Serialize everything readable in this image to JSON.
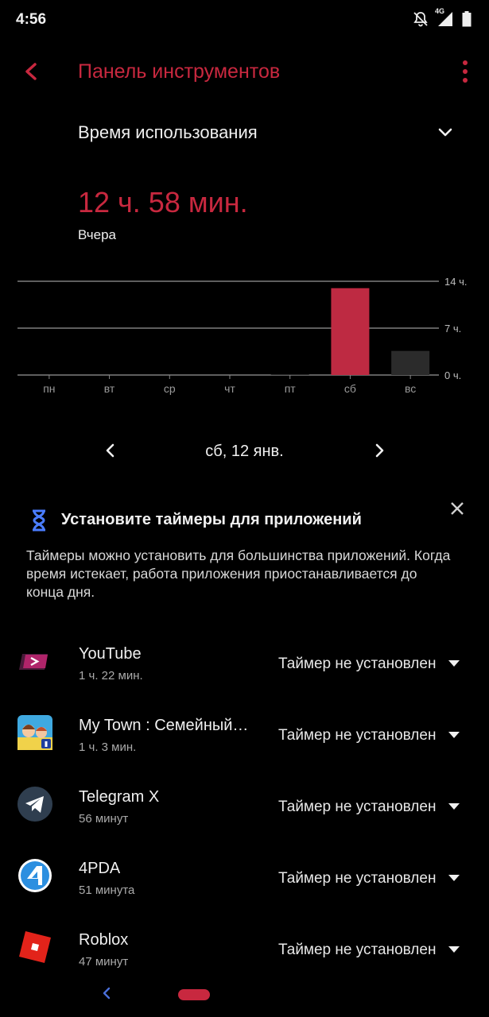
{
  "status_bar": {
    "time": "4:56",
    "network": "4G",
    "icons": [
      "bell-off-icon",
      "signal-icon",
      "battery-icon"
    ]
  },
  "app_bar": {
    "title": "Панель инструментов",
    "back_icon": "back-arrow-icon",
    "menu_icon": "more-vert-icon",
    "accent_color": "#c8283f"
  },
  "section_select": {
    "label": "Время использования",
    "icon": "chevron-down-icon"
  },
  "summary": {
    "total": "12 ч. 58 мин.",
    "day": "Вчера"
  },
  "chart_data": {
    "type": "bar",
    "categories": [
      "пн",
      "вт",
      "ср",
      "чт",
      "пт",
      "сб",
      "вс"
    ],
    "values": [
      0,
      0,
      0,
      0,
      0.05,
      12.97,
      3.6
    ],
    "selected_index": 5,
    "y_ticks": [
      "14 ч.",
      "7 ч.",
      "0 ч."
    ],
    "y_tick_values": [
      14,
      7,
      0
    ],
    "ylim": [
      0,
      14
    ],
    "grid": true,
    "colors": {
      "selected": "#be2a42",
      "default": "#2b2b2b",
      "grid": "#bdbdbd"
    }
  },
  "date_nav": {
    "label": "сб, 12 янв.",
    "prev_icon": "chevron-left-icon",
    "next_icon": "chevron-right-icon"
  },
  "promo": {
    "title": "Установите таймеры для приложений",
    "text": "Таймеры можно установить для большинства приложений. Когда время истекает, работа приложения приостанавливается до конца дня.",
    "icon": "hourglass-icon",
    "close_icon": "close-icon",
    "icon_color": "#4a7dff"
  },
  "apps": [
    {
      "name": "YouTube",
      "usage": "1 ч. 22 мин.",
      "timer": "Таймер не установлен",
      "icon": "youtube-app-icon"
    },
    {
      "name": "My Town : Семейный…",
      "usage": "1 ч. 3 мин.",
      "timer": "Таймер не установлен",
      "icon": "my-town-app-icon"
    },
    {
      "name": "Telegram X",
      "usage": "56 минут",
      "timer": "Таймер не установлен",
      "icon": "telegram-app-icon"
    },
    {
      "name": "4PDA",
      "usage": "51 минута",
      "timer": "Таймер не установлен",
      "icon": "4pda-app-icon"
    },
    {
      "name": "Roblox",
      "usage": "47 минут",
      "timer": "Таймер не установлен",
      "icon": "roblox-app-icon"
    }
  ],
  "nav_bar": {
    "back_icon": "nav-back-icon",
    "home_icon": "nav-home-pill"
  }
}
